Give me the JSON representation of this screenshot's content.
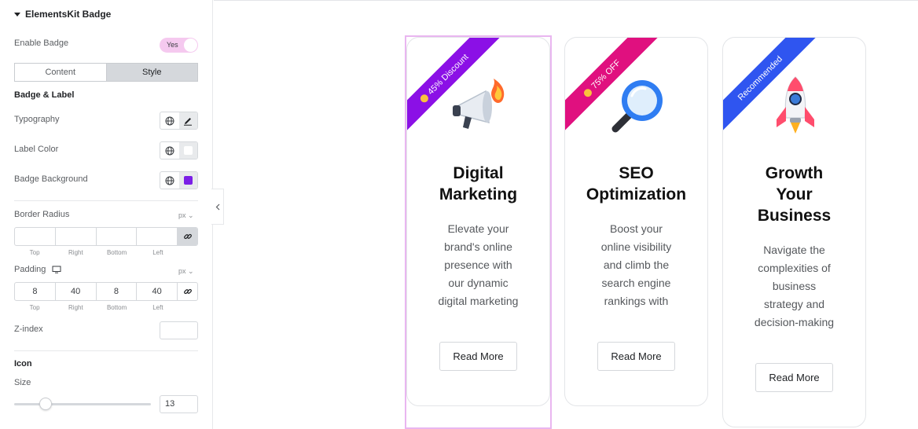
{
  "panel": {
    "title": "ElementsKit Badge",
    "enable_badge_label": "Enable Badge",
    "enable_badge_value": "Yes",
    "tabs": [
      {
        "label": "Content"
      },
      {
        "label": "Style"
      }
    ],
    "section_badge_label": "Badge & Label",
    "typography_label": "Typography",
    "label_color_label": "Label Color",
    "label_color": "#ffffff",
    "badge_background_label": "Badge Background",
    "badge_background": "#7b1fe6",
    "border_radius_label": "Border Radius",
    "unit": "px",
    "dim_caps": [
      "Top",
      "Right",
      "Bottom",
      "Left"
    ],
    "border_radius_values": [
      "",
      "",
      "",
      ""
    ],
    "padding_label": "Padding",
    "padding_values": [
      "8",
      "40",
      "8",
      "40"
    ],
    "zindex_label": "Z-index",
    "section_icon_label": "Icon",
    "size_label": "Size",
    "size_value": "13",
    "size_slider_fraction": 0.23
  },
  "cards": [
    {
      "badge": "45% Discount",
      "badge_color": "#8b10e6",
      "title_line1": "Digital",
      "title_line2": "Marketing",
      "title_line3": "",
      "desc": [
        "Elevate your",
        "brand's online",
        "presence with",
        "our dynamic",
        "digital marketing"
      ],
      "button": "Read More",
      "icon": "megaphone-icon"
    },
    {
      "badge": "75% OFF",
      "badge_color": "#e0107f",
      "title_line1": "SEO",
      "title_line2": "Optimization",
      "title_line3": "",
      "desc": [
        "Boost your",
        "online visibility",
        "and climb the",
        "search engine",
        "rankings with"
      ],
      "button": "Read More",
      "icon": "magnifier-icon"
    },
    {
      "badge": "Recommended",
      "badge_color": "#2f55f0",
      "title_line1": "Growth",
      "title_line2": "Your",
      "title_line3": "Business",
      "desc": [
        "Navigate the",
        "complexities of",
        "business",
        "strategy and",
        "decision-making"
      ],
      "button": "Read More",
      "icon": "rocket-icon"
    }
  ]
}
